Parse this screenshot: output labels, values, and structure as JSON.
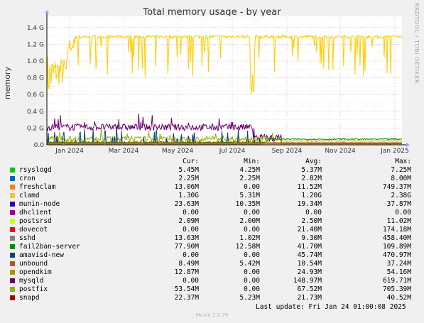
{
  "title": "Total memory usage - by year",
  "side_text": "RRDTOOL / TOBI OETIKER",
  "footer": "Munin 2.0.76",
  "last_update": "Last update: Fri Jan 24 01:00:08 2025",
  "chart_data": {
    "type": "line",
    "title": "Total memory usage - by year",
    "ylabel": "memory",
    "ylim": [
      0,
      1.5
    ],
    "y_ticks": [
      "0.0",
      "0.2 G",
      "0.4 G",
      "0.6 G",
      "0.8 G",
      "1.0 G",
      "1.2 G",
      "1.4 G"
    ],
    "y_tick_values": [
      0,
      0.2,
      0.4,
      0.6,
      0.8,
      1.0,
      1.2,
      1.4
    ],
    "x_ticks": [
      "Jan 2024",
      "Mar 2024",
      "May 2024",
      "Jul 2024",
      "Sep 2024",
      "Nov 2024",
      "Jan 2025"
    ],
    "columns": [
      "Cur:",
      "Min:",
      "Avg:",
      "Max:"
    ],
    "series": [
      {
        "name": "rsyslogd",
        "color": "#00cc00",
        "cur": "5.45M",
        "min": "4.25M",
        "avg": "5.37M",
        "max": "7.25M"
      },
      {
        "name": "cron",
        "color": "#0066b3",
        "cur": "2.25M",
        "min": "2.25M",
        "avg": "2.82M",
        "max": "8.00M"
      },
      {
        "name": "freshclam",
        "color": "#ff8000",
        "cur": "13.06M",
        "min": "0.00",
        "avg": "11.52M",
        "max": "749.37M"
      },
      {
        "name": "clamd",
        "color": "#ffcc00",
        "cur": "1.30G",
        "min": "5.31M",
        "avg": "1.20G",
        "max": "2.38G"
      },
      {
        "name": "munin-node",
        "color": "#330099",
        "cur": "23.63M",
        "min": "10.35M",
        "avg": "19.34M",
        "max": "37.87M"
      },
      {
        "name": "dhclient",
        "color": "#990099",
        "cur": "0.00",
        "min": "0.00",
        "avg": "0.00",
        "max": "0.00"
      },
      {
        "name": "postsrsd",
        "color": "#ccff00",
        "cur": "2.09M",
        "min": "2.00M",
        "avg": "2.50M",
        "max": "11.02M"
      },
      {
        "name": "dovecot",
        "color": "#ff0000",
        "cur": "0.00",
        "min": "0.00",
        "avg": "21.40M",
        "max": "174.18M"
      },
      {
        "name": "sshd",
        "color": "#808080",
        "cur": "13.63M",
        "min": "1.02M",
        "avg": "9.30M",
        "max": "458.40M"
      },
      {
        "name": "fail2ban-server",
        "color": "#008f00",
        "cur": "77.90M",
        "min": "12.58M",
        "avg": "41.70M",
        "max": "109.89M"
      },
      {
        "name": "amavisd-new",
        "color": "#00487d",
        "cur": "0.00",
        "min": "0.00",
        "avg": "45.74M",
        "max": "470.97M"
      },
      {
        "name": "unbound",
        "color": "#b35a00",
        "cur": "8.49M",
        "min": "5.42M",
        "avg": "10.54M",
        "max": "37.24M"
      },
      {
        "name": "opendkim",
        "color": "#b38f00",
        "cur": "12.87M",
        "min": "0.00",
        "avg": "24.93M",
        "max": "54.16M"
      },
      {
        "name": "mysqld",
        "color": "#6b006b",
        "cur": "0.00",
        "min": "0.00",
        "avg": "148.97M",
        "max": "619.71M"
      },
      {
        "name": "postfix",
        "color": "#8fb300",
        "cur": "53.54M",
        "min": "0.00",
        "avg": "67.52M",
        "max": "705.39M"
      },
      {
        "name": "snapd",
        "color": "#b30000",
        "cur": "22.37M",
        "min": "5.23M",
        "avg": "21.73M",
        "max": "40.52M"
      }
    ]
  }
}
